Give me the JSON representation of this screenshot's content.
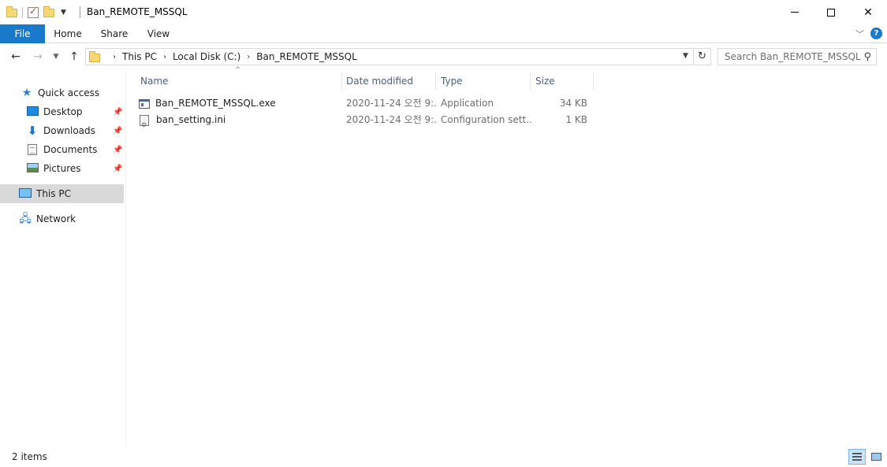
{
  "window": {
    "title": "Ban_REMOTE_MSSQL"
  },
  "ribbon": {
    "tabs": [
      "File",
      "Home",
      "Share",
      "View"
    ]
  },
  "address": {
    "crumbs": [
      "This PC",
      "Local Disk (C:)",
      "Ban_REMOTE_MSSQL"
    ]
  },
  "search": {
    "placeholder": "Search Ban_REMOTE_MSSQL"
  },
  "sidebar": {
    "items": [
      {
        "label": "Quick access",
        "icon": "star-icon"
      },
      {
        "label": "Desktop",
        "icon": "desktop-icon",
        "pinned": true
      },
      {
        "label": "Downloads",
        "icon": "downloads-icon",
        "pinned": true
      },
      {
        "label": "Documents",
        "icon": "documents-icon",
        "pinned": true
      },
      {
        "label": "Pictures",
        "icon": "pictures-icon",
        "pinned": true
      },
      {
        "label": "This PC",
        "icon": "computer-icon",
        "selected": true
      },
      {
        "label": "Network",
        "icon": "network-icon"
      }
    ]
  },
  "columns": {
    "name": "Name",
    "date": "Date modified",
    "type": "Type",
    "size": "Size"
  },
  "files": [
    {
      "name": "Ban_REMOTE_MSSQL.exe",
      "date": "2020-11-24 오전 9:...",
      "type": "Application",
      "size": "34 KB",
      "icon": "exe-icon"
    },
    {
      "name": "ban_setting.ini",
      "date": "2020-11-24 오전 9:...",
      "type": "Configuration sett...",
      "size": "1 KB",
      "icon": "ini-icon"
    }
  ],
  "status": {
    "item_count": "2 items"
  },
  "colors": {
    "accent": "#1979ca",
    "selected_bg": "#d9d9d9",
    "header_text": "#4c607a"
  }
}
